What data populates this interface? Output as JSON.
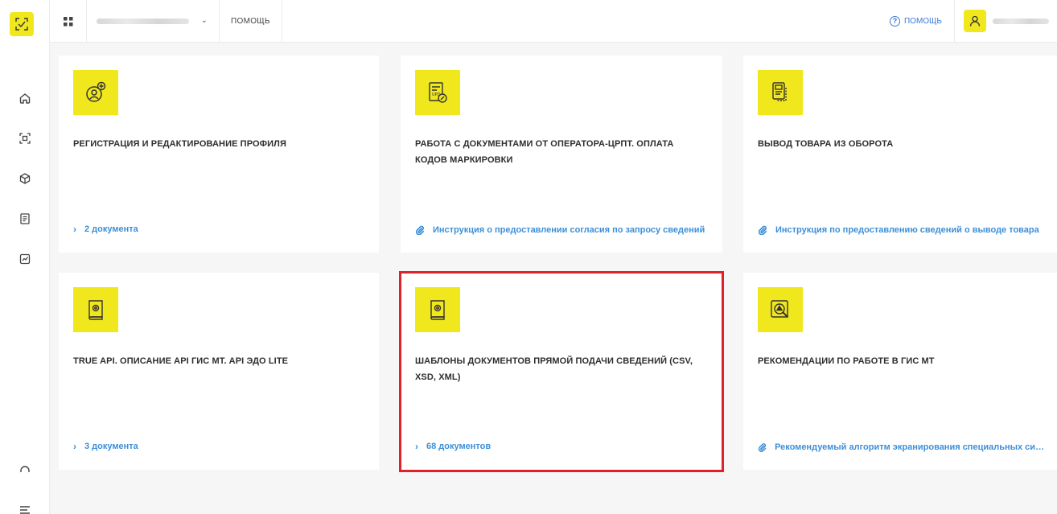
{
  "header": {
    "help_label": "ПОМОЩЬ",
    "help_right_label": "ПОМОЩЬ",
    "help_right_glyph": "?"
  },
  "cards": [
    {
      "title": "РЕГИСТРАЦИЯ И РЕДАКТИРОВАНИЕ ПРОФИЛЯ",
      "link": "2 документа",
      "link_type": "list"
    },
    {
      "title": "РАБОТА С ДОКУМЕНТАМИ ОТ ОПЕРАТОРА-ЦРПТ. ОПЛАТА КОДОВ МАРКИРОВКИ",
      "link": "Инструкция о предоставлении согласия по запросу сведений",
      "link_type": "file"
    },
    {
      "title": "ВЫВОД ТОВАРА ИЗ ОБОРОТА",
      "link": "Инструкция по предоставлению сведений о выводе товара",
      "link_type": "file"
    },
    {
      "title": "TRUE API. ОПИСАНИЕ API ГИС МТ. API ЭДО LITE",
      "link": "3 документа",
      "link_type": "list"
    },
    {
      "title": "ШАБЛОНЫ ДОКУМЕНТОВ ПРЯМОЙ ПОДАЧИ СВЕДЕНИЙ (CSV, XSD, XML)",
      "link": "68 документов",
      "link_type": "list"
    },
    {
      "title": "РЕКОМЕНДАЦИИ ПО РАБОТЕ В ГИС МТ",
      "link": "Рекомендуемый алгоритм экранирования специальных символов",
      "link_type": "file"
    }
  ],
  "icons": {
    "arrow": "›",
    "chevron": "⌄"
  },
  "colors": {
    "accent_yellow": "#f0e81d",
    "link_blue": "#3d8fd8",
    "highlight_red": "#e0202a"
  }
}
